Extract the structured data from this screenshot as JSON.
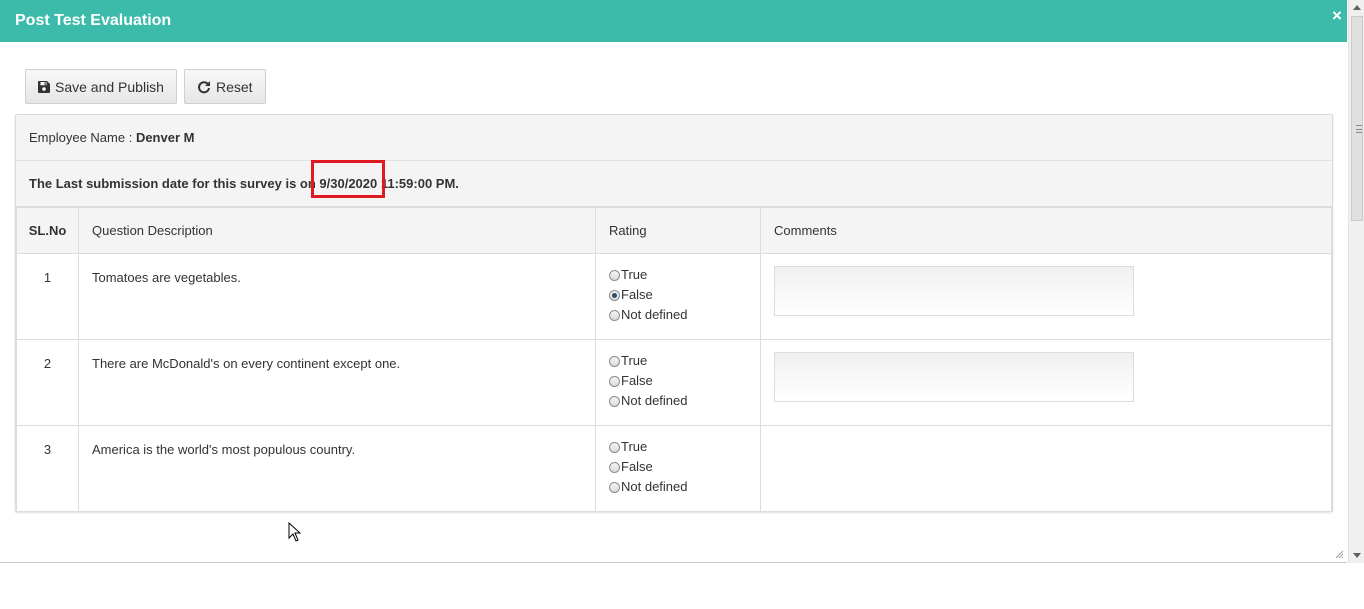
{
  "modal": {
    "title": "Post Test Evaluation",
    "close_label": "×"
  },
  "toolbar": {
    "save_label": "Save and Publish",
    "reset_label": "Reset"
  },
  "employee": {
    "label": "Employee Name : ",
    "name": "Denver M"
  },
  "submission": {
    "prefix": "The Last submission date for this survey is on ",
    "date": "9/30/2020",
    "suffix": " 11:59:00 PM."
  },
  "table": {
    "headers": {
      "sl": "SL.No",
      "question": "Question Description",
      "rating": "Rating",
      "comments": "Comments"
    },
    "rating_options": [
      "True",
      "False",
      "Not defined"
    ],
    "rows": [
      {
        "sl": "1",
        "question": "Tomatoes are vegetables.",
        "selected": "False",
        "has_comment_box": true
      },
      {
        "sl": "2",
        "question": "There are McDonald's on every continent except one.",
        "selected": "",
        "has_comment_box": true
      },
      {
        "sl": "3",
        "question": "America is the world's most populous country.",
        "selected": "",
        "has_comment_box": false
      }
    ]
  },
  "colors": {
    "header_bg": "#3cbbab",
    "highlight_border": "#e01a22"
  }
}
